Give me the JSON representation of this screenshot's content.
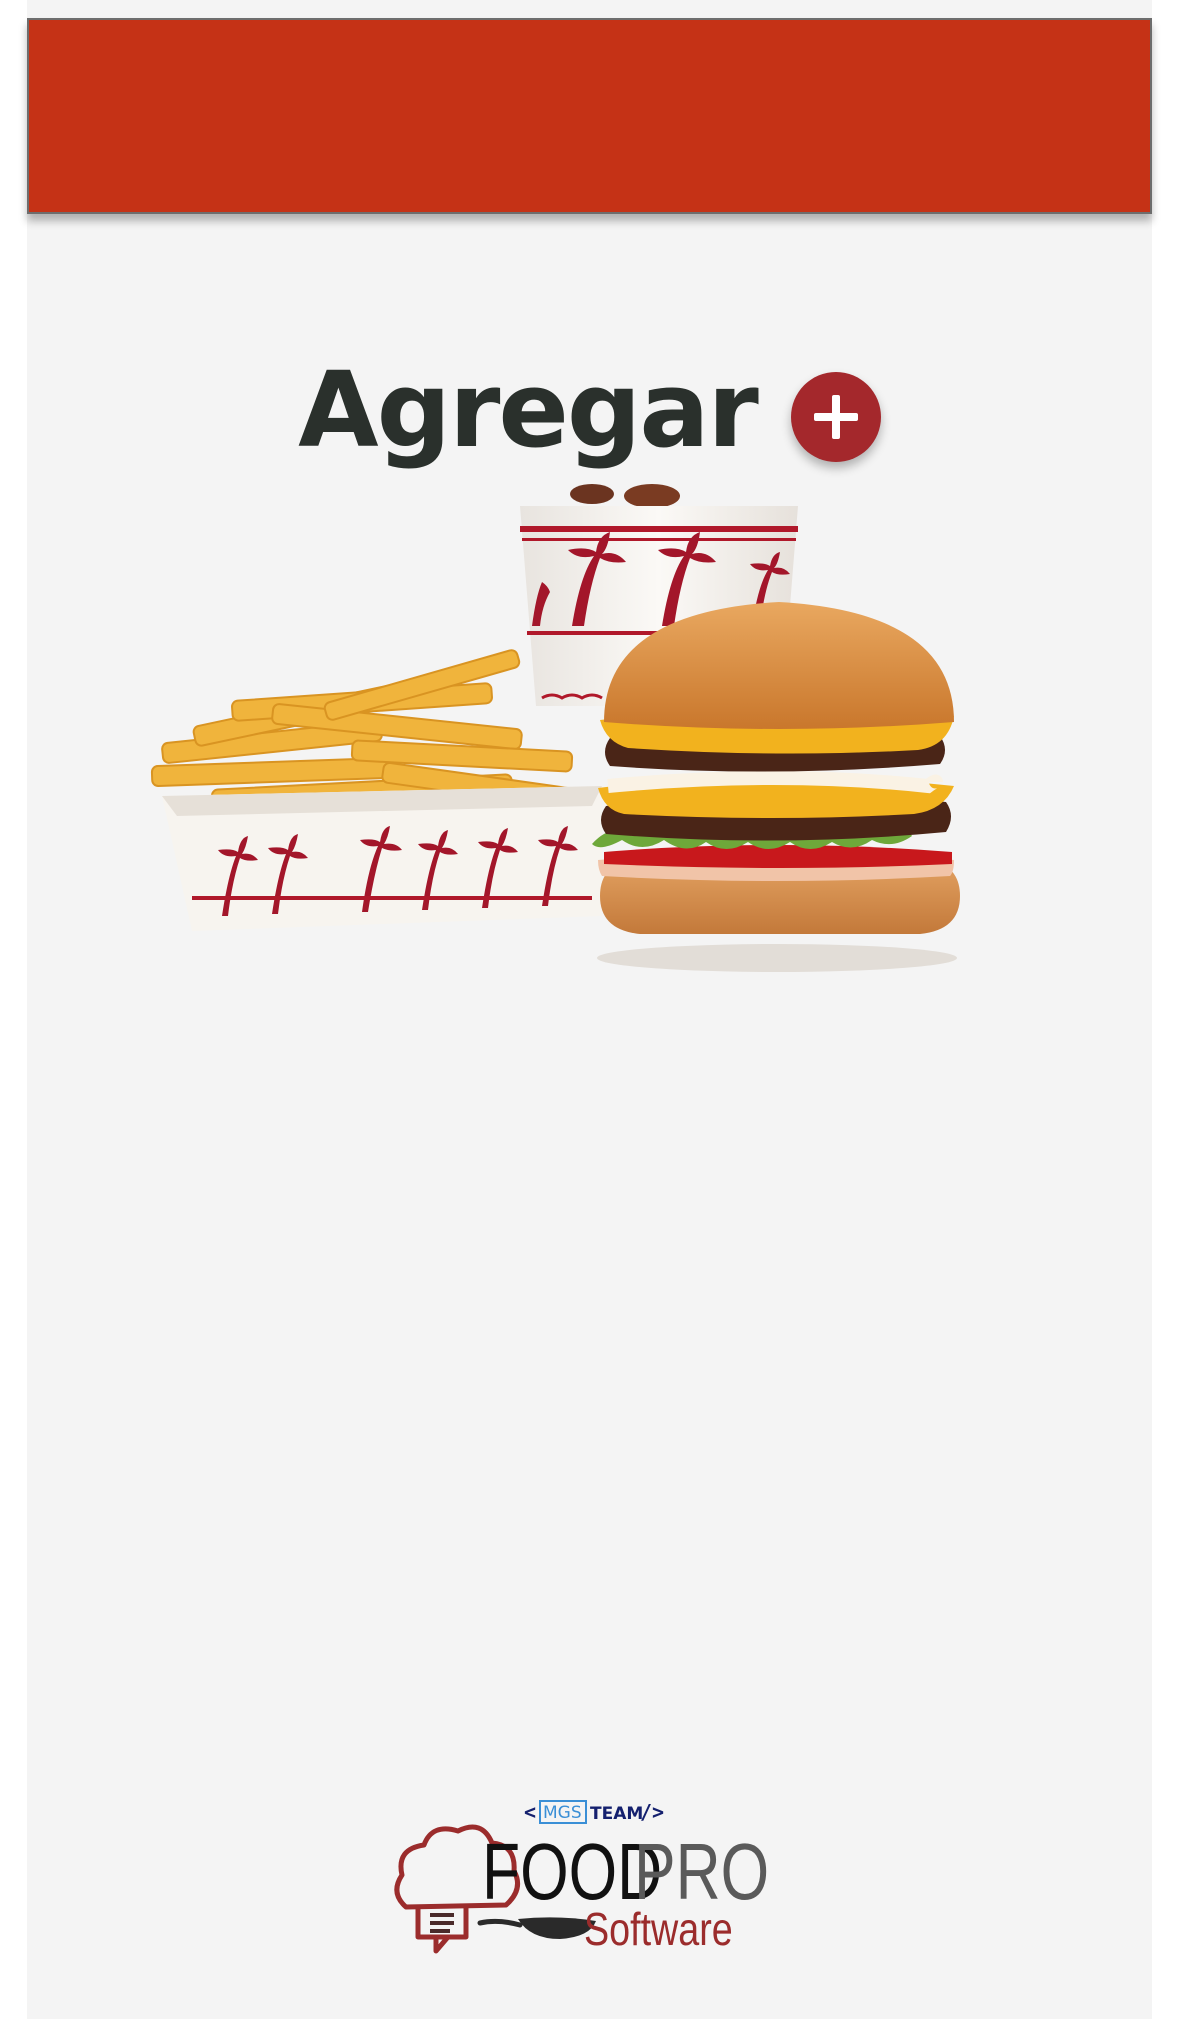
{
  "colors": {
    "topbar": "#c53216",
    "background": "#f4f4f4",
    "title": "#2a302c",
    "add_button": "#a4282c",
    "brand_red": "#9b2c2c",
    "brand_gray": "#5a5a5a",
    "mgs_blue": "#3a8fd6",
    "team_navy": "#14206e"
  },
  "header": {
    "title": "Agregar",
    "add_icon": "plus-icon"
  },
  "hero": {
    "image": "burger-fries-drink-image"
  },
  "footer": {
    "mgs_label": "MGS",
    "team_label": "TEAM",
    "brand_food": "FOOD",
    "brand_pro": "PRO",
    "brand_software": "Software"
  }
}
